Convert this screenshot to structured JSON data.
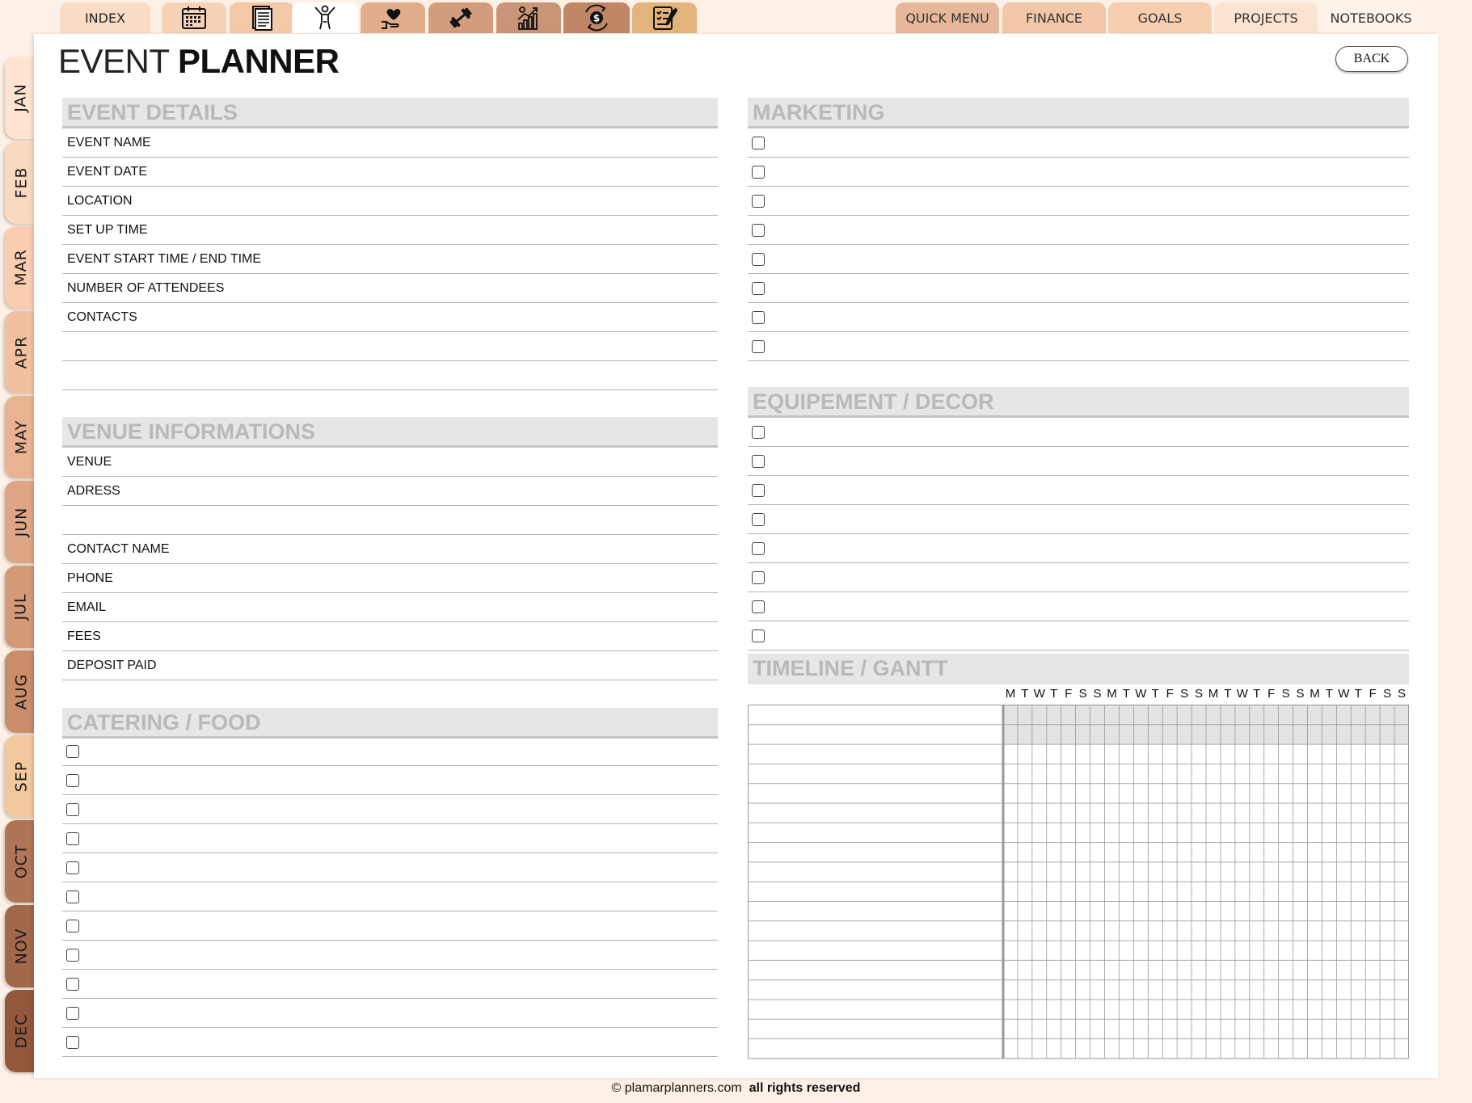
{
  "top_tabs": [
    {
      "label": "INDEX",
      "icon": "",
      "color": "#f9dcc6"
    },
    {
      "label": "",
      "icon": "calendar-icon",
      "color": "#f8d2b5"
    },
    {
      "label": "",
      "icon": "document-icon",
      "color": "#f4c9a8"
    },
    {
      "label": "",
      "icon": "person-icon",
      "color": "#ffffff"
    },
    {
      "label": "",
      "icon": "heart-hand-icon",
      "color": "#e2ad8c"
    },
    {
      "label": "",
      "icon": "dumbbell-icon",
      "color": "#d29d7c"
    },
    {
      "label": "",
      "icon": "growth-chart-icon",
      "color": "#c99576"
    },
    {
      "label": "",
      "icon": "money-exchange-icon",
      "color": "#c08766"
    },
    {
      "label": "",
      "icon": "checklist-icon",
      "color": "#e2b37c"
    }
  ],
  "nav_tabs": [
    {
      "label": "QUICK MENU",
      "color": "#e6b79a"
    },
    {
      "label": "FINANCE",
      "color": "#f2c7a8"
    },
    {
      "label": "GOALS",
      "color": "#f6cfb1"
    },
    {
      "label": "PROJECTS",
      "color": "#fae3cf"
    },
    {
      "label": "NOTEBOOKS",
      "color": "#fdf3ea"
    }
  ],
  "months": [
    {
      "label": "JAN",
      "color": "#fde3d0"
    },
    {
      "label": "FEB",
      "color": "#fbd8c0"
    },
    {
      "label": "MAR",
      "color": "#f9cdb0"
    },
    {
      "label": "APR",
      "color": "#f2c0a0"
    },
    {
      "label": "MAY",
      "color": "#e9b392"
    },
    {
      "label": "JUN",
      "color": "#dea685"
    },
    {
      "label": "JUL",
      "color": "#d49a78"
    },
    {
      "label": "AUG",
      "color": "#c98d6a"
    },
    {
      "label": "SEP",
      "color": "#f2c99e"
    },
    {
      "label": "OCT",
      "color": "#b07556"
    },
    {
      "label": "NOV",
      "color": "#a2684b"
    },
    {
      "label": "DEC",
      "color": "#93583c"
    }
  ],
  "page": {
    "title_light": "EVENT",
    "title_bold": "PLANNER",
    "back_label": "BACK"
  },
  "event_details": {
    "heading": "EVENT DETAILS",
    "rows": [
      "EVENT NAME",
      "EVENT DATE",
      "LOCATION",
      "SET UP TIME",
      "EVENT START TIME / END TIME",
      "NUMBER OF ATTENDEES",
      "CONTACTS",
      "",
      ""
    ]
  },
  "venue": {
    "heading": "VENUE INFORMATIONS",
    "rows": [
      "VENUE",
      "ADRESS",
      "",
      "CONTACT NAME",
      "PHONE",
      "EMAIL",
      "FEES",
      "DEPOSIT PAID"
    ]
  },
  "catering": {
    "heading": "CATERING / FOOD",
    "count": 11
  },
  "marketing": {
    "heading": "MARKETING",
    "count": 8
  },
  "equipment": {
    "heading": "EQUIPEMENT / DECOR",
    "count": 8
  },
  "timeline": {
    "heading": "TIMELINE / GANTT",
    "days": [
      "M",
      "T",
      "W",
      "T",
      "F",
      "S",
      "S",
      "M",
      "T",
      "W",
      "T",
      "F",
      "S",
      "S",
      "M",
      "T",
      "W",
      "T",
      "F",
      "S",
      "S",
      "M",
      "T",
      "W",
      "T",
      "F",
      "S",
      "S"
    ],
    "rows": 18
  },
  "footer": {
    "site": "© plamarplanners.com",
    "rights": "all rights reserved"
  }
}
